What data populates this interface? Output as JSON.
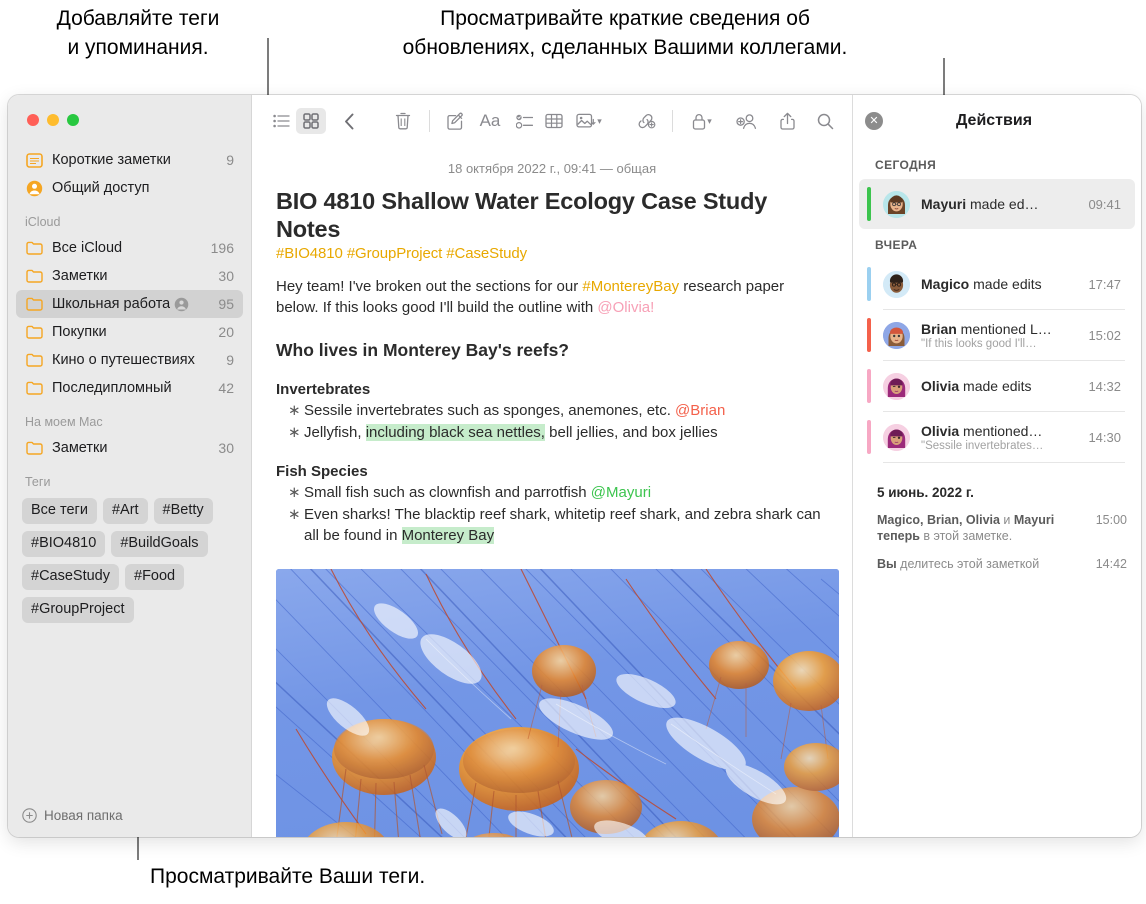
{
  "annotations": {
    "tags_callout": "Добавляйте теги\nи упоминания.",
    "activity_callout": "Просматривайте краткие сведения об\nобновлениях, сделанных Вашими коллегами.",
    "view_tags_callout": "Просматривайте Ваши теги."
  },
  "sidebar": {
    "top_items": [
      {
        "label": "Короткие заметки",
        "count": "9",
        "icon": "quick-note-icon",
        "shared": false
      },
      {
        "label": "Общий доступ",
        "count": "",
        "icon": "shared-person-icon",
        "shared": false
      }
    ],
    "sections": [
      {
        "header": "iCloud",
        "items": [
          {
            "label": "Все iCloud",
            "count": "196",
            "icon": "folder-icon",
            "shared": false,
            "selected": false
          },
          {
            "label": "Заметки",
            "count": "30",
            "icon": "folder-icon",
            "shared": false,
            "selected": false
          },
          {
            "label": "Школьная работа",
            "count": "95",
            "icon": "folder-icon",
            "shared": true,
            "selected": true
          },
          {
            "label": "Покупки",
            "count": "20",
            "icon": "folder-icon",
            "shared": false,
            "selected": false
          },
          {
            "label": "Кино о путешествиях",
            "count": "9",
            "icon": "folder-icon",
            "shared": false,
            "selected": false
          },
          {
            "label": "Последипломный",
            "count": "42",
            "icon": "folder-icon",
            "shared": false,
            "selected": false
          }
        ]
      },
      {
        "header": "На моем Mac",
        "items": [
          {
            "label": "Заметки",
            "count": "30",
            "icon": "folder-icon",
            "shared": false,
            "selected": false
          }
        ]
      }
    ],
    "tags_header": "Теги",
    "tags": [
      "Все теги",
      "#Art",
      "#Betty",
      "#BIO4810",
      "#BuildGoals",
      "#CaseStudy",
      "#Food",
      "#GroupProject"
    ],
    "new_folder_label": "Новая папка"
  },
  "toolbar": {
    "list_view": "list-view-icon",
    "gallery_view": "gallery-view-icon",
    "back": "chevron-left-icon",
    "delete": "trash-icon",
    "compose": "compose-icon",
    "format": "Aa",
    "checklist": "checklist-icon",
    "table": "table-icon",
    "media": "media-icon",
    "link": "link-add-icon",
    "lock": "lock-icon",
    "add_people": "add-person-icon",
    "share": "share-icon",
    "search": "search-icon"
  },
  "note": {
    "date": "18 октября 2022 г., 09:41 — общая",
    "title": "BIO 4810 Shallow Water Ecology Case Study Notes",
    "tags": "#BIO4810 #GroupProject #CaseStudy",
    "intro_part1": "Hey team! I've broken out the sections for our ",
    "intro_tag": "#MontereyBay",
    "intro_part2": " research paper below. If this looks good I'll build the outline with ",
    "intro_mention": "@Olivia!",
    "heading": "Who lives in Monterey Bay's reefs?",
    "sections": [
      {
        "subheading": "Invertebrates",
        "bullets": [
          {
            "prefix": "Sessile invertebrates such as sponges, anemones, etc. ",
            "mention": "@Brian",
            "mention_color": "red",
            "suffix": ""
          },
          {
            "prefix": "Jellyfish, ",
            "highlight": "including black sea nettles,",
            "suffix": " bell jellies, and box jellies"
          }
        ]
      },
      {
        "subheading": "Fish Species",
        "bullets": [
          {
            "prefix": "Small fish such as clownfish and parrotfish ",
            "mention": "@Mayuri",
            "mention_color": "green",
            "suffix": ""
          },
          {
            "prefix": "Even sharks! The blacktip reef shark, whitetip reef shark, and zebra shark can all be found in ",
            "highlight": "Monterey Bay",
            "suffix": ""
          }
        ]
      }
    ],
    "image_alt": "jellyfish-photo"
  },
  "activity": {
    "title": "Действия",
    "close": "close-icon",
    "groups": [
      {
        "header": "СЕГОДНЯ",
        "items": [
          {
            "name": "Mayuri",
            "action": " made ed…",
            "sub": "",
            "time": "09:41",
            "bar": "#3cc44e",
            "avatar": "#b8e6ea",
            "selected": true
          }
        ]
      },
      {
        "header": "ВЧЕРА",
        "items": [
          {
            "name": "Magico",
            "action": " made edits",
            "sub": "",
            "time": "17:47",
            "bar": "#9bd0f0",
            "avatar": "#d3eaf7",
            "selected": false
          },
          {
            "name": "Brian",
            "action": " mentioned L…",
            "sub": "\"If this looks good I'll…",
            "time": "15:02",
            "bar": "#f4614b",
            "avatar": "#8fa7e6",
            "selected": false
          },
          {
            "name": "Olivia",
            "action": " made edits",
            "sub": "",
            "time": "14:32",
            "bar": "#f7a8c4",
            "avatar": "#f6d0e2",
            "selected": false
          },
          {
            "name": "Olivia",
            "action": " mentioned…",
            "sub": "\"Sessile invertebrates…",
            "time": "14:30",
            "bar": "#f7a8c4",
            "avatar": "#f6d0e2",
            "selected": false
          }
        ]
      }
    ],
    "footer_date": "5 июнь. 2022 г.",
    "footer_rows": [
      {
        "bold_lead": "Magico, Brian, Olivia",
        "mid": " и ",
        "bold_two": "Mayuri",
        "tail_bold": "теперь",
        "tail": " в этой заметке.",
        "time": "15:00"
      },
      {
        "bold_lead": "Вы",
        "mid": "",
        "bold_two": "",
        "tail_bold": "",
        "tail": " делитесь этой заметкой",
        "time": "14:42"
      }
    ]
  },
  "colors": {
    "accent_orange": "#e8a800",
    "folder_orange": "#f5a623",
    "highlight_green": "#c6eccb",
    "selected_gray": "#d2d2d2"
  }
}
